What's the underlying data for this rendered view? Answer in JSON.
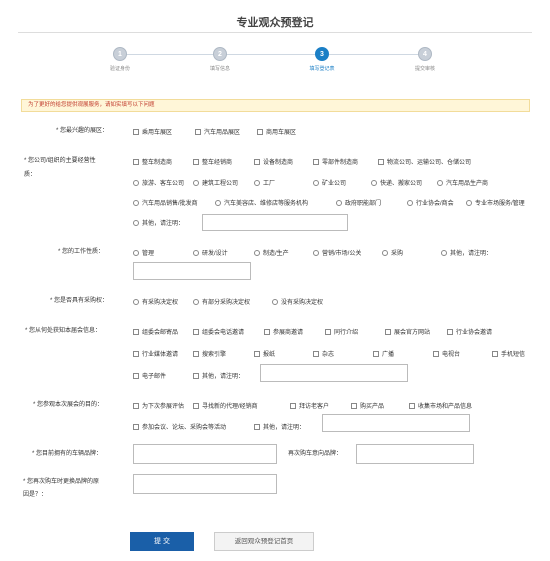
{
  "title": "专业观众预登记",
  "steps": [
    {
      "num": "1",
      "label": "验证身份"
    },
    {
      "num": "2",
      "label": "填写信息"
    },
    {
      "num": "3",
      "label": "填写登记表"
    },
    {
      "num": "4",
      "label": "提交审核"
    }
  ],
  "notice": "为了更好的给您提供观展服务，请如实填写以下问题",
  "q1": {
    "label": "* 您最兴趣的展区：",
    "options": [
      "乘用车展区",
      "汽车用品展区",
      "商用车展区"
    ]
  },
  "q2": {
    "label_line1": "* 您公司/组织的主要经营性",
    "label_line2": "质：",
    "options": [
      "整车制造商",
      "整车经销商",
      "设备制造商",
      "零部件制造商",
      "物流公司、运输公司、仓储公司",
      "旅游、客车公司",
      "建筑工程公司",
      "工厂",
      "矿业公司",
      "快递、搬家公司",
      "汽车用品生产商",
      "汽车用品销售/批发商",
      "汽车美容店、维修店等服务机构",
      "政府职能部门",
      "行业协会/商会",
      "专业市场服务/管理",
      "其他，请注明："
    ]
  },
  "q3": {
    "label": "* 您的工作性质：",
    "options": [
      "管理",
      "研发/设计",
      "制造/生产",
      "营销/市场/公关",
      "采购",
      "其他，请注明："
    ]
  },
  "q4": {
    "label": "* 您是否具有采购权：",
    "options": [
      "有采购决定权",
      "有部分采购决定权",
      "没有采购决定权"
    ]
  },
  "q5": {
    "label": "* 您从何处获知本届会信息：",
    "options": [
      "组委会邮寄品",
      "组委会电话邀请",
      "参展商邀请",
      "同行介绍",
      "展会官方网站",
      "行业协会邀请",
      "行业媒体邀请",
      "搜索引擎",
      "报纸",
      "杂志",
      "广播",
      "电视台",
      "手机短信",
      "电子邮件",
      "其他，请注明："
    ]
  },
  "q6": {
    "label": "* 您参观本次展会的目的：",
    "options": [
      "为下次参展评估",
      "寻找新的代理/经销商",
      "拜访老客户",
      "购买产品",
      "收集市场和产品信息",
      "参加会议、论坛、采购会等活动",
      "其他，请注明："
    ]
  },
  "q7": {
    "label": "* 您目前拥有的车辆品牌：",
    "label2": "再次购车意向品牌："
  },
  "q8": {
    "label_line1": "* 您再次购车时更换品牌的原",
    "label_line2": "因是？："
  },
  "buttons": {
    "submit": "提 交",
    "back": "返回观众预登记首页"
  }
}
